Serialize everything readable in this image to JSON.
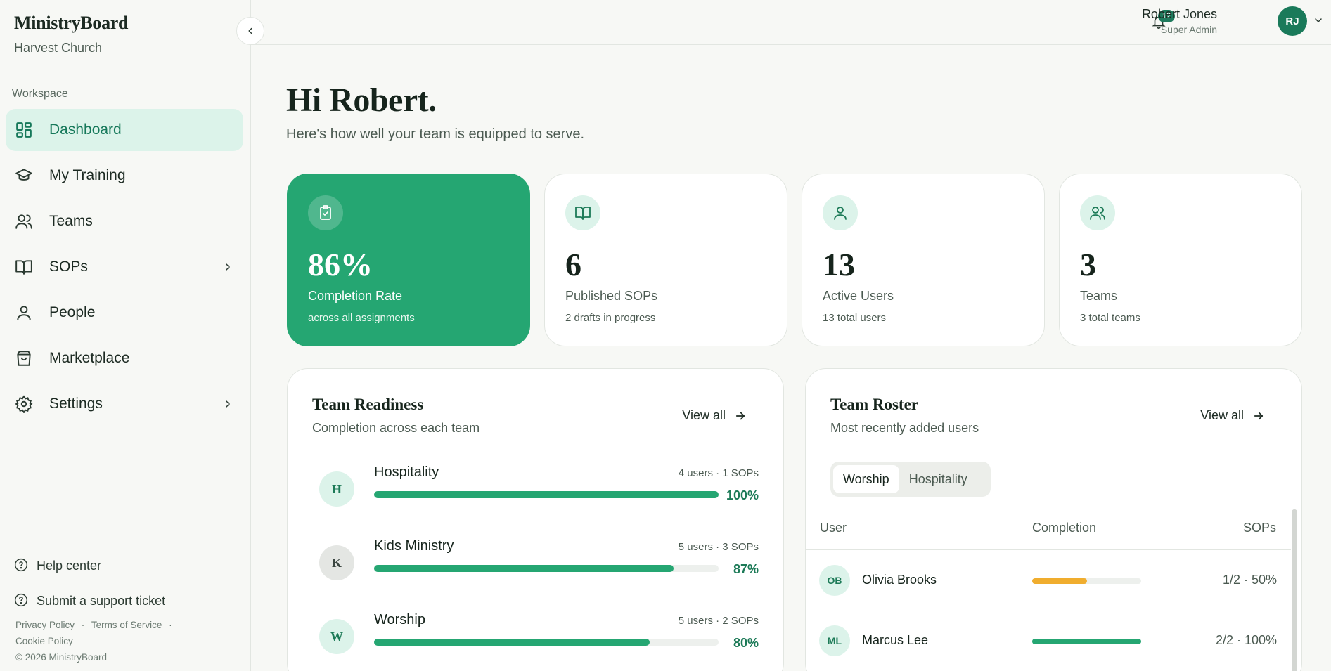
{
  "brand": {
    "title": "MinistryBoard",
    "org": "Harvest Church"
  },
  "nav": {
    "section_label": "Workspace",
    "items": [
      {
        "label": "Dashboard",
        "icon": "dashboard-icon",
        "active": true
      },
      {
        "label": "My Training",
        "icon": "graduation-cap-icon"
      },
      {
        "label": "Teams",
        "icon": "users-icon"
      },
      {
        "label": "SOPs",
        "icon": "book-icon",
        "expandable": true
      },
      {
        "label": "People",
        "icon": "user-icon"
      },
      {
        "label": "Marketplace",
        "icon": "shopping-bag-icon"
      },
      {
        "label": "Settings",
        "icon": "gear-icon",
        "expandable": true
      }
    ]
  },
  "footer": {
    "help": "Help center",
    "support": "Submit a support ticket",
    "privacy": "Privacy Policy",
    "terms": "Terms of Service",
    "cookie": "Cookie Policy",
    "copyright": "© 2026 MinistryBoard",
    "separator": "·"
  },
  "topbar": {
    "notifications": "12",
    "user_name": "Robert Jones",
    "user_role": "Super Admin",
    "user_initials": "RJ"
  },
  "greeting": {
    "title": "Hi Robert.",
    "subtitle": "Here's how well your team is equipped to serve."
  },
  "stats": [
    {
      "value": "86%",
      "label": "Completion Rate",
      "sub": "across all assignments",
      "icon": "clipboard-check-icon"
    },
    {
      "value": "6",
      "label": "Published SOPs",
      "sub": "2 drafts in progress",
      "icon": "book-icon"
    },
    {
      "value": "13",
      "label": "Active Users",
      "sub": "13 total users",
      "icon": "user-icon"
    },
    {
      "value": "3",
      "label": "Teams",
      "sub": "3 total teams",
      "icon": "users-icon"
    }
  ],
  "readiness": {
    "title": "Team Readiness",
    "subtitle": "Completion across each team",
    "view_all": "View all",
    "teams": [
      {
        "initial": "H",
        "name": "Hospitality",
        "meta": "4 users · 1 SOPs",
        "pct_label": "100%",
        "pct": 100
      },
      {
        "initial": "K",
        "name": "Kids Ministry",
        "meta": "5 users · 3 SOPs",
        "pct_label": "87%",
        "pct": 87
      },
      {
        "initial": "W",
        "name": "Worship",
        "meta": "5 users · 2 SOPs",
        "pct_label": "80%",
        "pct": 80
      }
    ]
  },
  "roster": {
    "title": "Team Roster",
    "subtitle": "Most recently added users",
    "view_all": "View all",
    "tabs": [
      "Worship",
      "Hospitality"
    ],
    "columns": {
      "user": "User",
      "completion": "Completion",
      "sops": "SOPs"
    },
    "rows": [
      {
        "initials": "OB",
        "name": "Olivia Brooks",
        "value": "1/2 · 50%",
        "pct": 50,
        "color": "#f0ad2e"
      },
      {
        "initials": "ML",
        "name": "Marcus Lee",
        "value": "2/2 · 100%",
        "pct": 100,
        "color": "#25a672"
      }
    ]
  },
  "colors": {
    "accent": "#25a672",
    "accent_dark": "#1a7a5a",
    "warning": "#f0ad2e"
  }
}
